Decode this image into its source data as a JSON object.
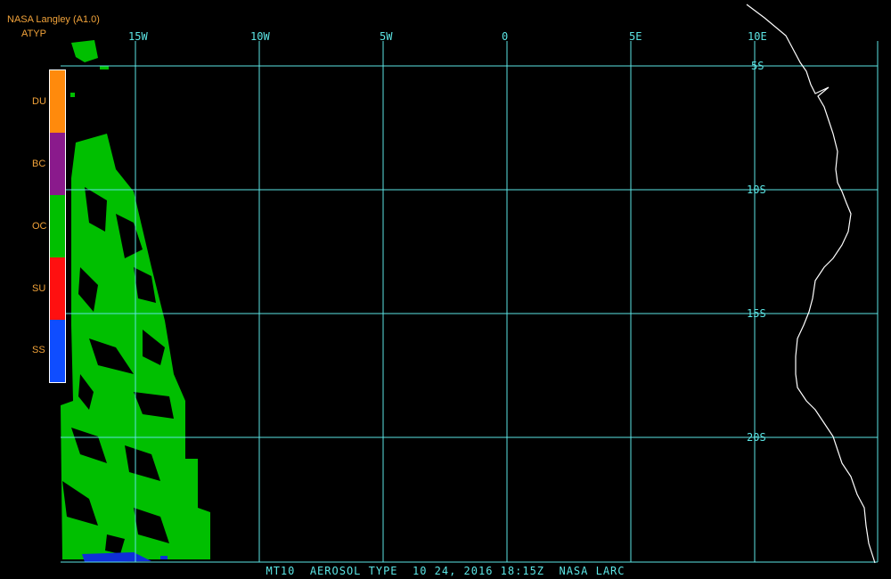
{
  "header": {
    "title": "NASA Langley (A1.0)",
    "product": "ATYP"
  },
  "legend": [
    {
      "label": "DU",
      "color": "#ff8a0c"
    },
    {
      "label": "BC",
      "color": "#8a1a8c"
    },
    {
      "label": "OC",
      "color": "#00bf00"
    },
    {
      "label": "SU",
      "color": "#ff1010"
    },
    {
      "label": "SS",
      "color": "#0f4dff"
    }
  ],
  "longitude_labels": [
    "15W",
    "10W",
    "5W",
    "0",
    "5E",
    "10E"
  ],
  "latitude_labels": [
    "5S",
    "10S",
    "15S",
    "20S"
  ],
  "footer": "MT10  AEROSOL TYPE  10 24, 2016 18:15Z  NASA LARC",
  "colors": {
    "grid": "#5ce5e5",
    "background": "#000000",
    "coastline": "#ffffff",
    "label": "#f2a33a"
  }
}
